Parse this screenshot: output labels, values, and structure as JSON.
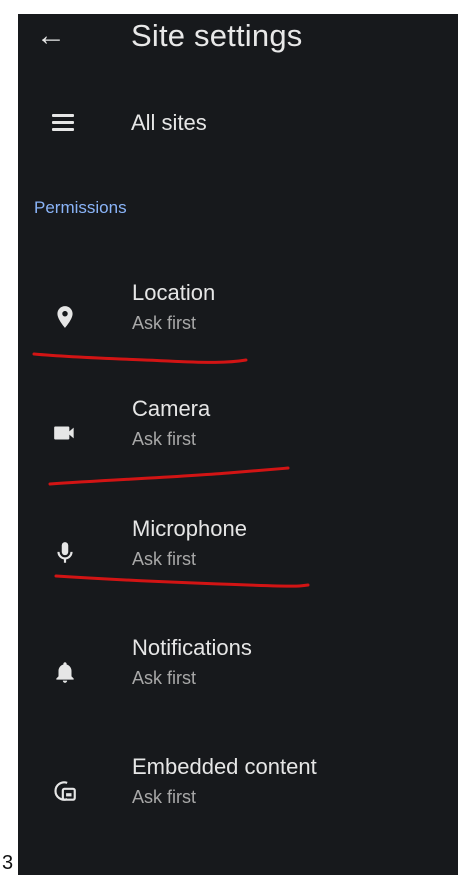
{
  "appbar": {
    "back_icon": "arrow-back-icon",
    "title": "Site settings"
  },
  "all_sites": {
    "icon": "list-icon",
    "label": "All sites"
  },
  "section": {
    "label": "Permissions"
  },
  "permissions": [
    {
      "name": "Location",
      "status": "Ask first",
      "icon": "location-pin-icon"
    },
    {
      "name": "Camera",
      "status": "Ask first",
      "icon": "camera-icon"
    },
    {
      "name": "Microphone",
      "status": "Ask first",
      "icon": "microphone-icon"
    },
    {
      "name": "Notifications",
      "status": "Ask first",
      "icon": "bell-icon"
    },
    {
      "name": "Embedded content",
      "status": "Ask first",
      "icon": "embedded-content-icon"
    }
  ],
  "outer_fragment": "3",
  "colors": {
    "background": "#17191c",
    "text_primary": "#e6e6e6",
    "text_secondary": "#a8a8a8",
    "section_accent": "#8ab4f8",
    "annotation_red": "#d21414"
  }
}
